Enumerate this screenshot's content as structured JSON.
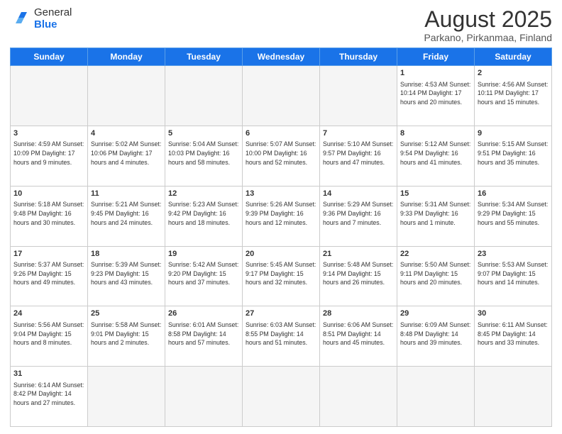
{
  "header": {
    "logo_general": "General",
    "logo_blue": "Blue",
    "title": "August 2025",
    "subtitle": "Parkano, Pirkanmaa, Finland"
  },
  "weekdays": [
    "Sunday",
    "Monday",
    "Tuesday",
    "Wednesday",
    "Thursday",
    "Friday",
    "Saturday"
  ],
  "weeks": [
    [
      {
        "day": "",
        "info": ""
      },
      {
        "day": "",
        "info": ""
      },
      {
        "day": "",
        "info": ""
      },
      {
        "day": "",
        "info": ""
      },
      {
        "day": "",
        "info": ""
      },
      {
        "day": "1",
        "info": "Sunrise: 4:53 AM\nSunset: 10:14 PM\nDaylight: 17 hours\nand 20 minutes."
      },
      {
        "day": "2",
        "info": "Sunrise: 4:56 AM\nSunset: 10:11 PM\nDaylight: 17 hours\nand 15 minutes."
      }
    ],
    [
      {
        "day": "3",
        "info": "Sunrise: 4:59 AM\nSunset: 10:09 PM\nDaylight: 17 hours\nand 9 minutes."
      },
      {
        "day": "4",
        "info": "Sunrise: 5:02 AM\nSunset: 10:06 PM\nDaylight: 17 hours\nand 4 minutes."
      },
      {
        "day": "5",
        "info": "Sunrise: 5:04 AM\nSunset: 10:03 PM\nDaylight: 16 hours\nand 58 minutes."
      },
      {
        "day": "6",
        "info": "Sunrise: 5:07 AM\nSunset: 10:00 PM\nDaylight: 16 hours\nand 52 minutes."
      },
      {
        "day": "7",
        "info": "Sunrise: 5:10 AM\nSunset: 9:57 PM\nDaylight: 16 hours\nand 47 minutes."
      },
      {
        "day": "8",
        "info": "Sunrise: 5:12 AM\nSunset: 9:54 PM\nDaylight: 16 hours\nand 41 minutes."
      },
      {
        "day": "9",
        "info": "Sunrise: 5:15 AM\nSunset: 9:51 PM\nDaylight: 16 hours\nand 35 minutes."
      }
    ],
    [
      {
        "day": "10",
        "info": "Sunrise: 5:18 AM\nSunset: 9:48 PM\nDaylight: 16 hours\nand 30 minutes."
      },
      {
        "day": "11",
        "info": "Sunrise: 5:21 AM\nSunset: 9:45 PM\nDaylight: 16 hours\nand 24 minutes."
      },
      {
        "day": "12",
        "info": "Sunrise: 5:23 AM\nSunset: 9:42 PM\nDaylight: 16 hours\nand 18 minutes."
      },
      {
        "day": "13",
        "info": "Sunrise: 5:26 AM\nSunset: 9:39 PM\nDaylight: 16 hours\nand 12 minutes."
      },
      {
        "day": "14",
        "info": "Sunrise: 5:29 AM\nSunset: 9:36 PM\nDaylight: 16 hours\nand 7 minutes."
      },
      {
        "day": "15",
        "info": "Sunrise: 5:31 AM\nSunset: 9:33 PM\nDaylight: 16 hours\nand 1 minute."
      },
      {
        "day": "16",
        "info": "Sunrise: 5:34 AM\nSunset: 9:29 PM\nDaylight: 15 hours\nand 55 minutes."
      }
    ],
    [
      {
        "day": "17",
        "info": "Sunrise: 5:37 AM\nSunset: 9:26 PM\nDaylight: 15 hours\nand 49 minutes."
      },
      {
        "day": "18",
        "info": "Sunrise: 5:39 AM\nSunset: 9:23 PM\nDaylight: 15 hours\nand 43 minutes."
      },
      {
        "day": "19",
        "info": "Sunrise: 5:42 AM\nSunset: 9:20 PM\nDaylight: 15 hours\nand 37 minutes."
      },
      {
        "day": "20",
        "info": "Sunrise: 5:45 AM\nSunset: 9:17 PM\nDaylight: 15 hours\nand 32 minutes."
      },
      {
        "day": "21",
        "info": "Sunrise: 5:48 AM\nSunset: 9:14 PM\nDaylight: 15 hours\nand 26 minutes."
      },
      {
        "day": "22",
        "info": "Sunrise: 5:50 AM\nSunset: 9:11 PM\nDaylight: 15 hours\nand 20 minutes."
      },
      {
        "day": "23",
        "info": "Sunrise: 5:53 AM\nSunset: 9:07 PM\nDaylight: 15 hours\nand 14 minutes."
      }
    ],
    [
      {
        "day": "24",
        "info": "Sunrise: 5:56 AM\nSunset: 9:04 PM\nDaylight: 15 hours\nand 8 minutes."
      },
      {
        "day": "25",
        "info": "Sunrise: 5:58 AM\nSunset: 9:01 PM\nDaylight: 15 hours\nand 2 minutes."
      },
      {
        "day": "26",
        "info": "Sunrise: 6:01 AM\nSunset: 8:58 PM\nDaylight: 14 hours\nand 57 minutes."
      },
      {
        "day": "27",
        "info": "Sunrise: 6:03 AM\nSunset: 8:55 PM\nDaylight: 14 hours\nand 51 minutes."
      },
      {
        "day": "28",
        "info": "Sunrise: 6:06 AM\nSunset: 8:51 PM\nDaylight: 14 hours\nand 45 minutes."
      },
      {
        "day": "29",
        "info": "Sunrise: 6:09 AM\nSunset: 8:48 PM\nDaylight: 14 hours\nand 39 minutes."
      },
      {
        "day": "30",
        "info": "Sunrise: 6:11 AM\nSunset: 8:45 PM\nDaylight: 14 hours\nand 33 minutes."
      }
    ],
    [
      {
        "day": "31",
        "info": "Sunrise: 6:14 AM\nSunset: 8:42 PM\nDaylight: 14 hours\nand 27 minutes."
      },
      {
        "day": "",
        "info": ""
      },
      {
        "day": "",
        "info": ""
      },
      {
        "day": "",
        "info": ""
      },
      {
        "day": "",
        "info": ""
      },
      {
        "day": "",
        "info": ""
      },
      {
        "day": "",
        "info": ""
      }
    ]
  ]
}
